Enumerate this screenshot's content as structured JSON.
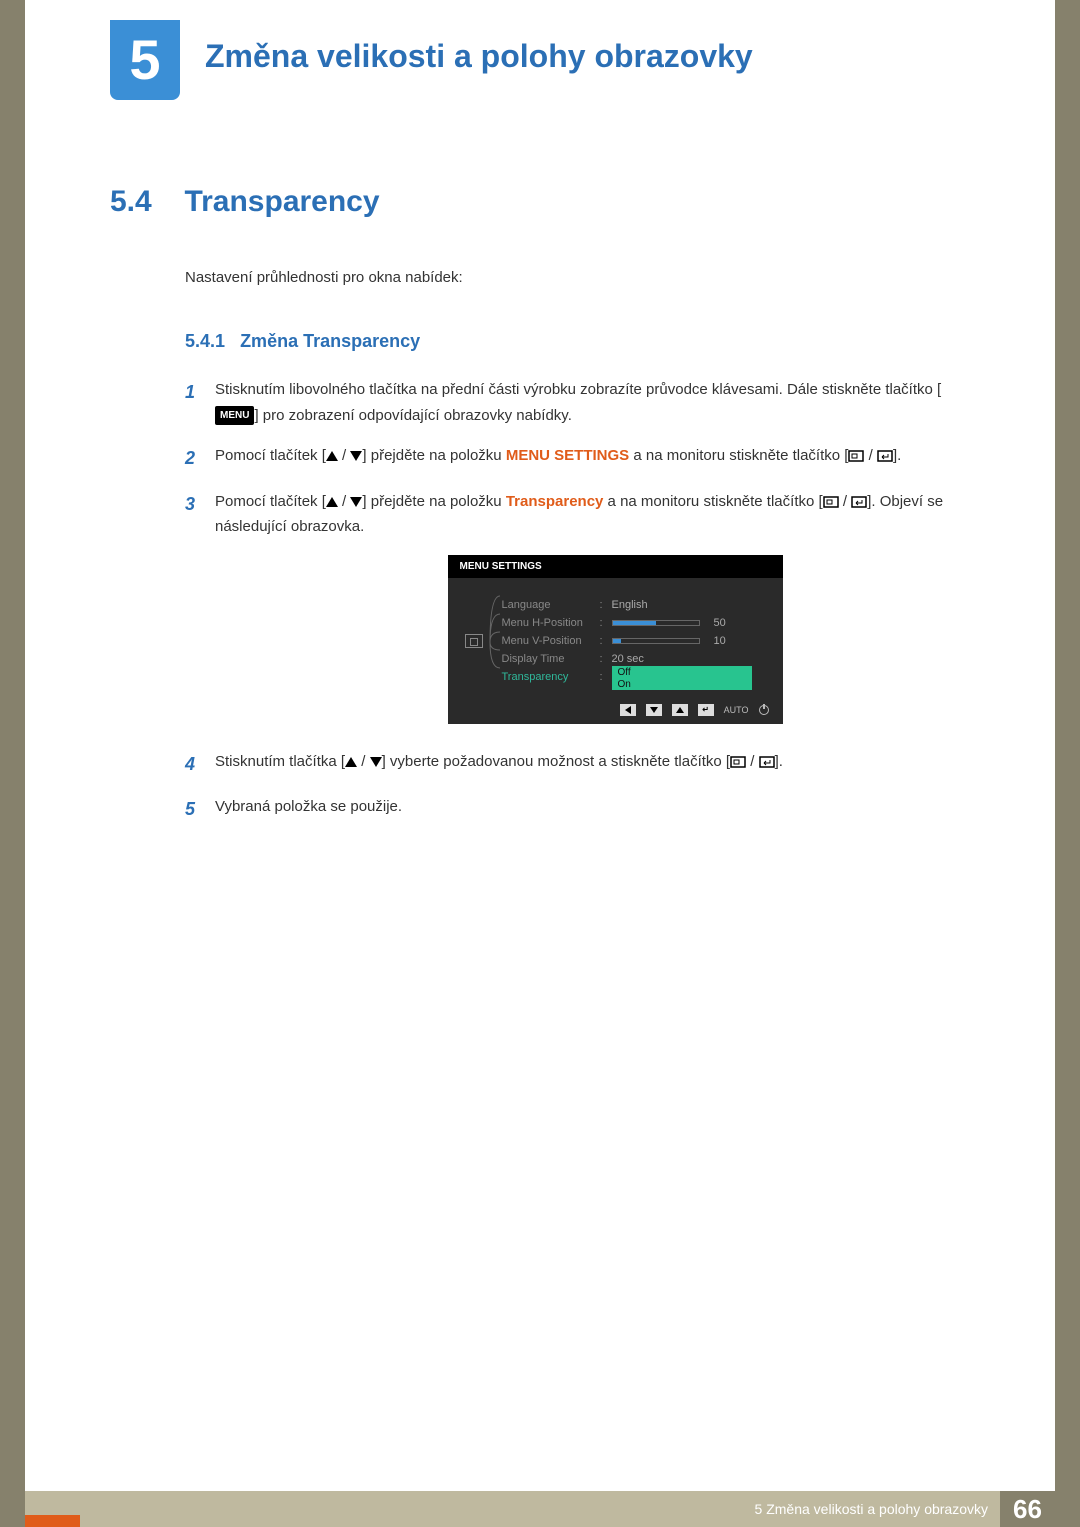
{
  "chapter": {
    "number": "5",
    "title": "Změna velikosti a polohy obrazovky"
  },
  "section": {
    "number": "5.4",
    "title": "Transparency"
  },
  "intro": "Nastavení průhlednosti pro okna nabídek:",
  "subsection": {
    "number": "5.4.1",
    "title": "Změna Transparency"
  },
  "steps": {
    "s1": {
      "num": "1",
      "a": "Stisknutím libovolného tlačítka na přední části výrobku zobrazíte průvodce klávesami. Dále stiskněte tlačítko [",
      "menu": "MENU",
      "b": "] pro zobrazení odpovídající obrazovky nabídky."
    },
    "s2": {
      "num": "2",
      "a": "Pomocí tlačítek [",
      "b": "] přejděte na položku ",
      "emph": "MENU SETTINGS",
      "c": " a na monitoru stiskněte tlačítko [",
      "d": "]."
    },
    "s3": {
      "num": "3",
      "a": "Pomocí tlačítek [",
      "b": "] přejděte na položku ",
      "emph": "Transparency",
      "c": " a na monitoru stiskněte tlačítko [",
      "d": "]. Objeví se následující obrazovka."
    },
    "s4": {
      "num": "4",
      "a": "Stisknutím tlačítka [",
      "b": "] vyberte požadovanou možnost a stiskněte tlačítko [",
      "c": "]."
    },
    "s5": {
      "num": "5",
      "a": "Vybraná položka se použije."
    }
  },
  "osd": {
    "header": "MENU SETTINGS",
    "rows": {
      "language": {
        "label": "Language",
        "value": "English"
      },
      "hpos": {
        "label": "Menu H-Position",
        "value": "50",
        "fill": 50
      },
      "vpos": {
        "label": "Menu V-Position",
        "value": "10",
        "fill": 10
      },
      "dtime": {
        "label": "Display Time",
        "value": "20 sec"
      },
      "transparency": {
        "label": "Transparency",
        "opt_off": "Off",
        "opt_on": "On"
      }
    },
    "auto": "AUTO"
  },
  "footer": {
    "text": "5 Změna velikosti a polohy obrazovky",
    "page": "66"
  }
}
